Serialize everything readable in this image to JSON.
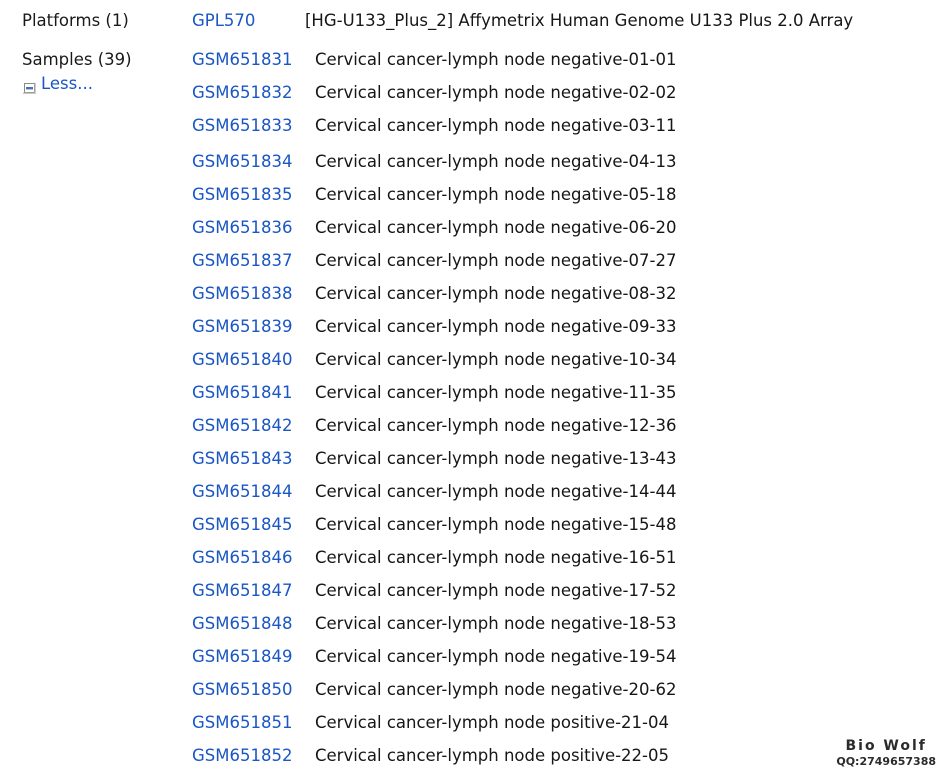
{
  "colors": {
    "link": "#1a56c4",
    "text": "#161616",
    "background": "#ffffff",
    "icon_border": "#8a8a8a",
    "icon_bar": "#4a6fb5"
  },
  "platforms": {
    "label": "Platforms (1)",
    "items": [
      {
        "accession": "GPL570",
        "title": "[HG-U133_Plus_2] Affymetrix Human Genome U133 Plus 2.0 Array"
      }
    ]
  },
  "samples": {
    "label": "Samples (39)",
    "toggle": {
      "label": "Less...",
      "icon": "collapse-box-icon"
    },
    "items": [
      {
        "accession": "GSM651831",
        "description": "Cervical cancer-lymph node negative-01-01"
      },
      {
        "accession": "GSM651832",
        "description": "Cervical cancer-lymph node negative-02-02"
      },
      {
        "accession": "GSM651833",
        "description": "Cervical cancer-lymph node negative-03-11"
      },
      {
        "accession": "GSM651834",
        "description": "Cervical cancer-lymph node negative-04-13"
      },
      {
        "accession": "GSM651835",
        "description": "Cervical cancer-lymph node negative-05-18"
      },
      {
        "accession": "GSM651836",
        "description": "Cervical cancer-lymph node negative-06-20"
      },
      {
        "accession": "GSM651837",
        "description": "Cervical cancer-lymph node negative-07-27"
      },
      {
        "accession": "GSM651838",
        "description": "Cervical cancer-lymph node negative-08-32"
      },
      {
        "accession": "GSM651839",
        "description": "Cervical cancer-lymph node negative-09-33"
      },
      {
        "accession": "GSM651840",
        "description": "Cervical cancer-lymph node negative-10-34"
      },
      {
        "accession": "GSM651841",
        "description": "Cervical cancer-lymph node negative-11-35"
      },
      {
        "accession": "GSM651842",
        "description": "Cervical cancer-lymph node negative-12-36"
      },
      {
        "accession": "GSM651843",
        "description": "Cervical cancer-lymph node negative-13-43"
      },
      {
        "accession": "GSM651844",
        "description": "Cervical cancer-lymph node negative-14-44"
      },
      {
        "accession": "GSM651845",
        "description": "Cervical cancer-lymph node negative-15-48"
      },
      {
        "accession": "GSM651846",
        "description": "Cervical cancer-lymph node negative-16-51"
      },
      {
        "accession": "GSM651847",
        "description": "Cervical cancer-lymph node negative-17-52"
      },
      {
        "accession": "GSM651848",
        "description": "Cervical cancer-lymph node negative-18-53"
      },
      {
        "accession": "GSM651849",
        "description": "Cervical cancer-lymph node negative-19-54"
      },
      {
        "accession": "GSM651850",
        "description": "Cervical cancer-lymph node negative-20-62"
      },
      {
        "accession": "GSM651851",
        "description": "Cervical cancer-lymph node positive-21-04"
      },
      {
        "accession": "GSM651852",
        "description": "Cervical cancer-lymph node positive-22-05"
      }
    ]
  },
  "watermark": {
    "title": "Bio Wolf",
    "subtitle": "QQ:2749657388"
  }
}
